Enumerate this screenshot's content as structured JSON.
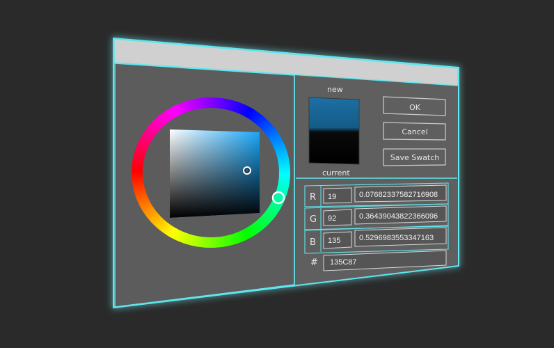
{
  "colors": {
    "background": "#2a2a2a",
    "panel": "#5f5f5f",
    "title_bar": "#cfcfcf",
    "glow_border": "#5fe6ee",
    "selected_color": "#135C87",
    "previous_color": "#000000"
  },
  "preview": {
    "new_label": "new",
    "current_label": "current"
  },
  "buttons": {
    "ok_label": "OK",
    "cancel_label": "Cancel",
    "save_swatch_label": "Save Swatch"
  },
  "channels": [
    {
      "name": "R",
      "int_value": "19",
      "float_value": "0.07682337582716908"
    },
    {
      "name": "G",
      "int_value": "92",
      "float_value": "0.36439043822366096"
    },
    {
      "name": "B",
      "int_value": "135",
      "float_value": "0.5296983553347163"
    }
  ],
  "hex": {
    "label": "#",
    "value": "135C87"
  },
  "picker": {
    "hue_degrees": 202,
    "saturation": 0.86,
    "value": 0.53
  }
}
